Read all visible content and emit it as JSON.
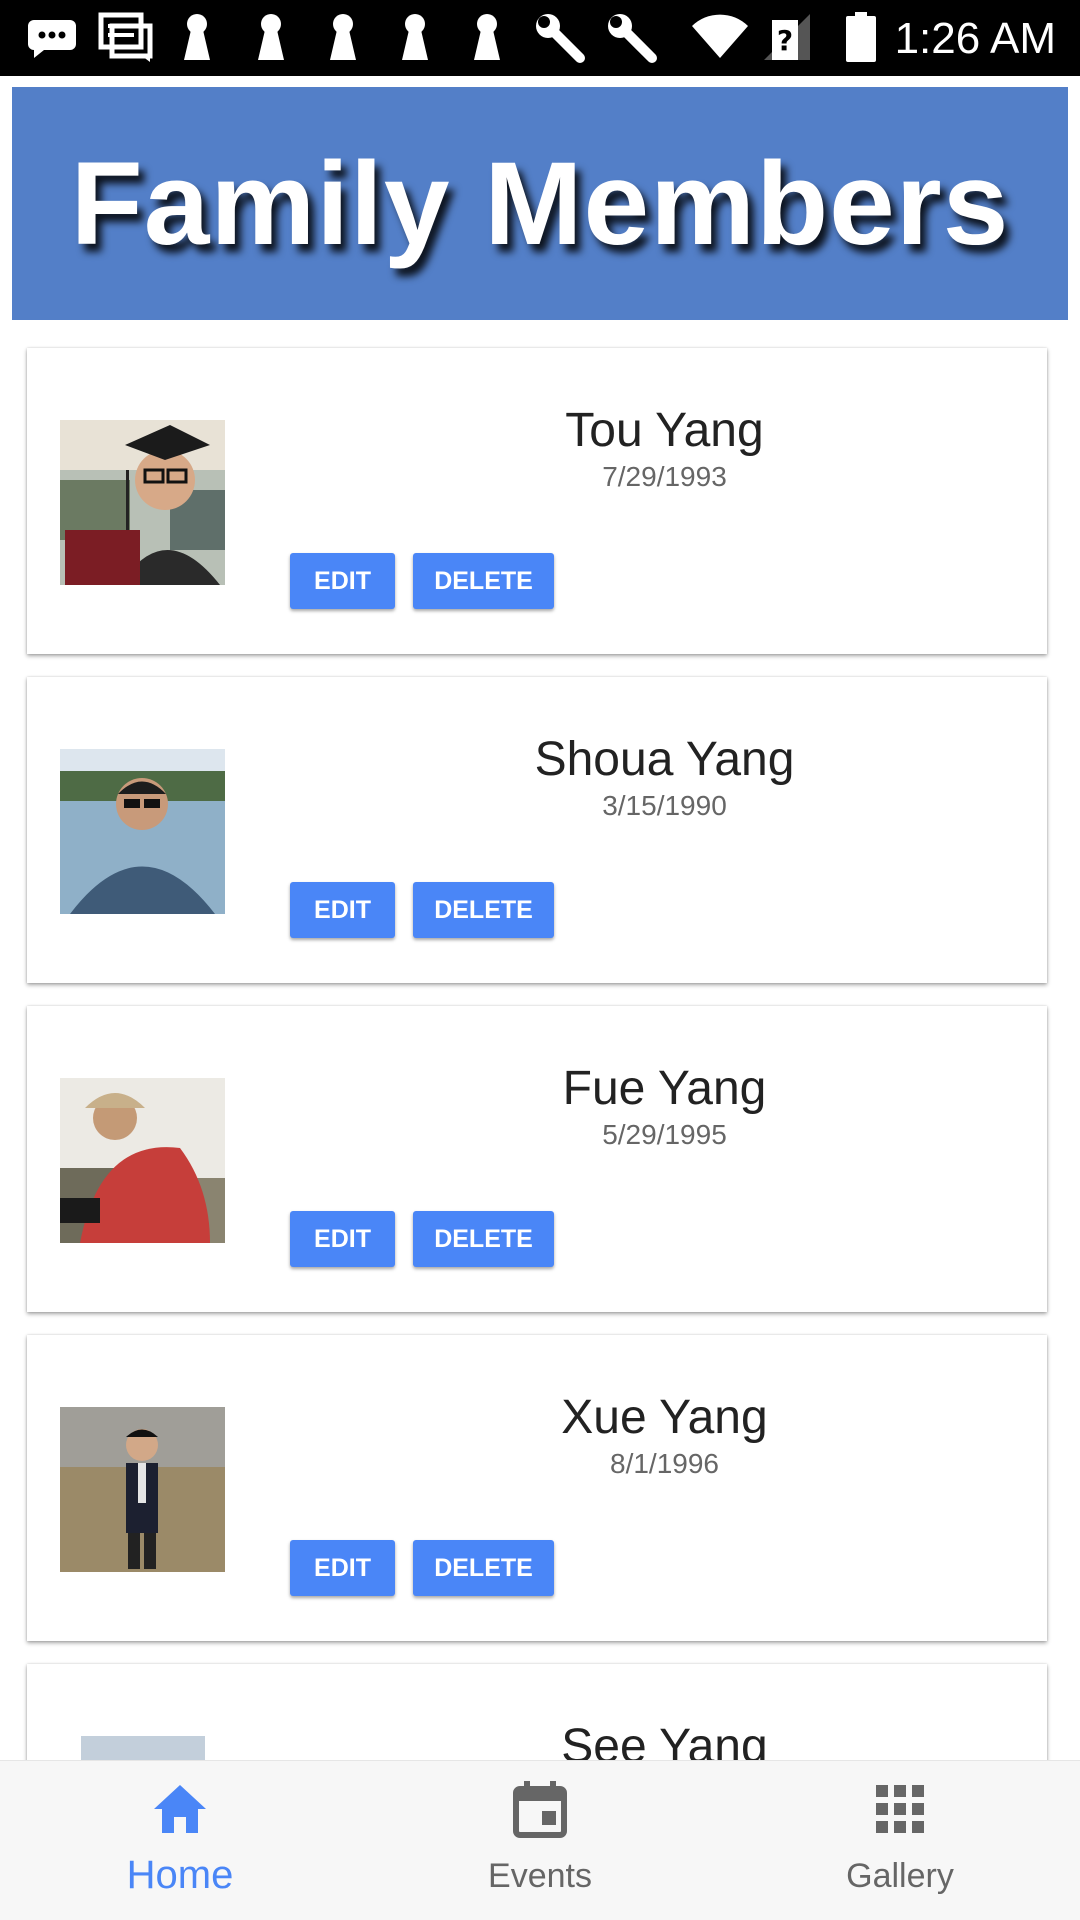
{
  "status_bar": {
    "time": "1:26 AM",
    "icons": [
      "message-icon",
      "chat-icon",
      "keyhole-icon",
      "keyhole-icon",
      "keyhole-icon",
      "keyhole-icon",
      "keyhole-icon",
      "wrench-icon",
      "wrench-icon",
      "wifi-icon",
      "no-signal-icon",
      "battery-icon"
    ]
  },
  "header": {
    "title": "Family Members",
    "background_color": "#537fc8"
  },
  "members": [
    {
      "name": "Tou Yang",
      "dob": "7/29/1993",
      "edit_label": "EDIT",
      "delete_label": "DELETE"
    },
    {
      "name": "Shoua Yang",
      "dob": "3/15/1990",
      "edit_label": "EDIT",
      "delete_label": "DELETE"
    },
    {
      "name": "Fue Yang",
      "dob": "5/29/1995",
      "edit_label": "EDIT",
      "delete_label": "DELETE"
    },
    {
      "name": "Xue Yang",
      "dob": "8/1/1996",
      "edit_label": "EDIT",
      "delete_label": "DELETE"
    },
    {
      "name": "See Yang"
    }
  ],
  "bottom_nav": {
    "items": [
      {
        "label": "Home",
        "icon": "home-icon",
        "active": true
      },
      {
        "label": "Events",
        "icon": "calendar-icon",
        "active": false
      },
      {
        "label": "Gallery",
        "icon": "grid-icon",
        "active": false
      }
    ]
  },
  "colors": {
    "accent": "#4a86f7",
    "button": "#4a86f7"
  }
}
